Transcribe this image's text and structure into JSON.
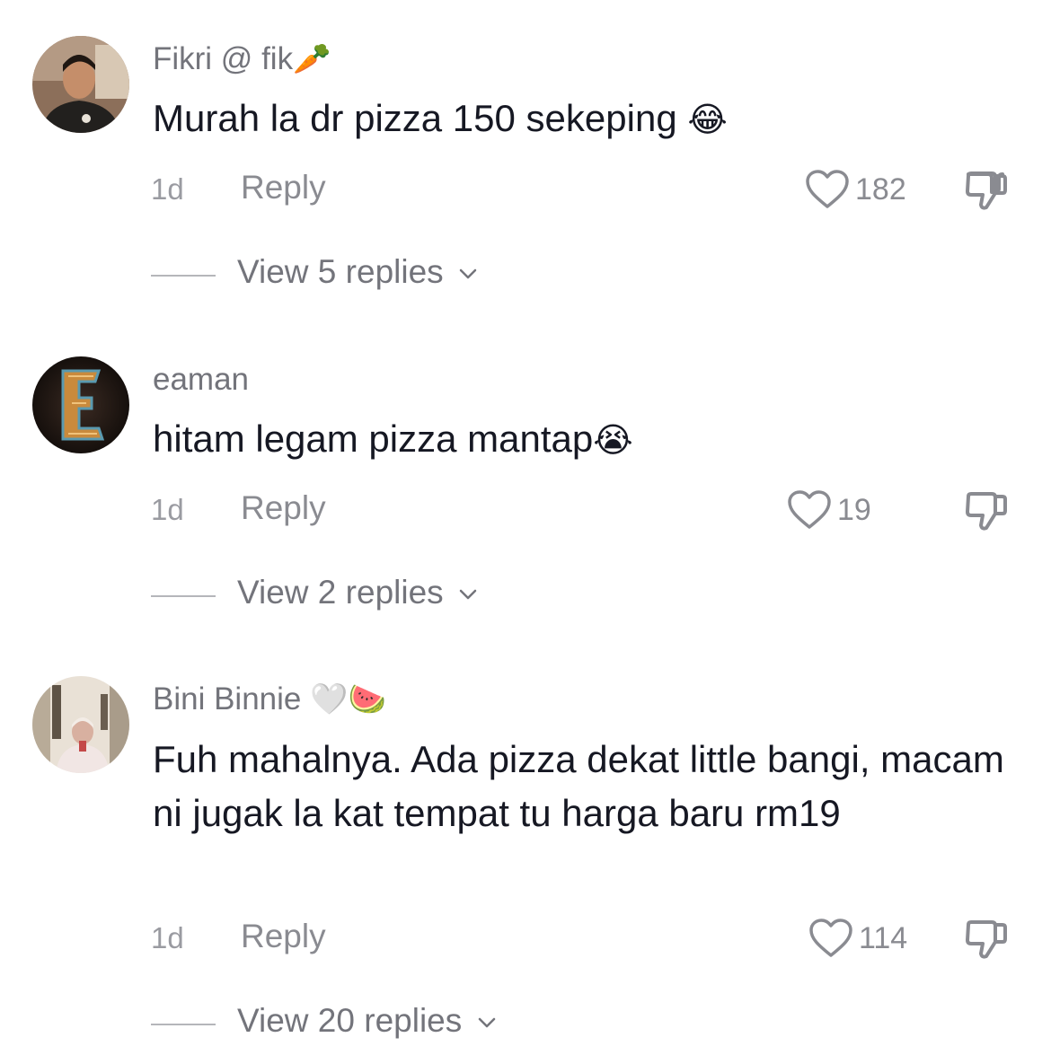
{
  "colors": {
    "text_primary": "#161823",
    "text_secondary": "#73747b",
    "text_muted": "#9a9ba1",
    "icon_gray": "#8a8b91"
  },
  "comments": [
    {
      "username": "Fikri @ fik",
      "username_emoji": "🥕",
      "text": "Murah la dr pizza 150 sekeping",
      "text_emoji": "😂",
      "time": "1d",
      "reply_label": "Reply",
      "likes": "182",
      "view_replies": "View 5 replies"
    },
    {
      "username": "eaman",
      "username_emoji": "",
      "text": "hitam legam pizza mantap",
      "text_emoji": "😭",
      "time": "1d",
      "reply_label": "Reply",
      "likes": "19",
      "view_replies": "View 2 replies"
    },
    {
      "username": "Bini Binnie",
      "username_emoji": "🤍🍉",
      "text": "Fuh mahalnya. Ada pizza dekat little bangi, macam ni jugak la kat tempat tu harga baru rm19",
      "text_emoji": "",
      "time": "1d",
      "reply_label": "Reply",
      "likes": "114",
      "view_replies": "View 20 replies"
    }
  ]
}
